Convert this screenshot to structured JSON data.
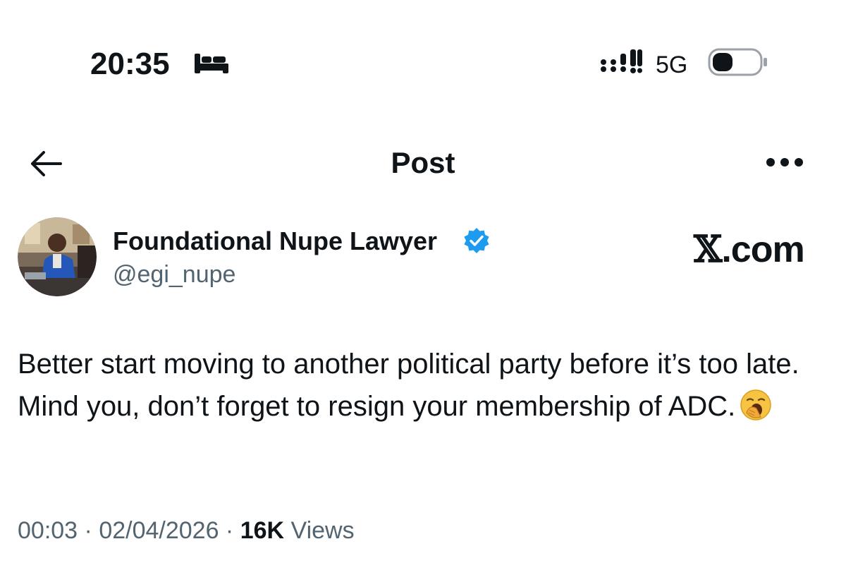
{
  "status_bar": {
    "time": "20:35",
    "network": "5G"
  },
  "header": {
    "title": "Post"
  },
  "author": {
    "name": "Foundational Nupe Lawyer",
    "handle": "@egi_nupe",
    "verified": true
  },
  "brand": {
    "x": "𝕏",
    "suffix": ".com"
  },
  "post": {
    "text": "Better start moving to another political party before it’s too late. Mind you, don’t forget to resign your membership of ADC.",
    "emoji": "yawning-face"
  },
  "meta": {
    "time": "00:03",
    "separator": " · ",
    "date": "02/04/2026",
    "views_count": "16K",
    "views_label": "Views"
  },
  "colors": {
    "text": "#0f1419",
    "secondary": "#536471",
    "verified": "#1d9bf0"
  },
  "icons": [
    "bed-icon",
    "signal-icon",
    "battery-icon",
    "back-arrow-icon",
    "more-icon",
    "verified-badge-icon",
    "yawning-face-emoji"
  ]
}
